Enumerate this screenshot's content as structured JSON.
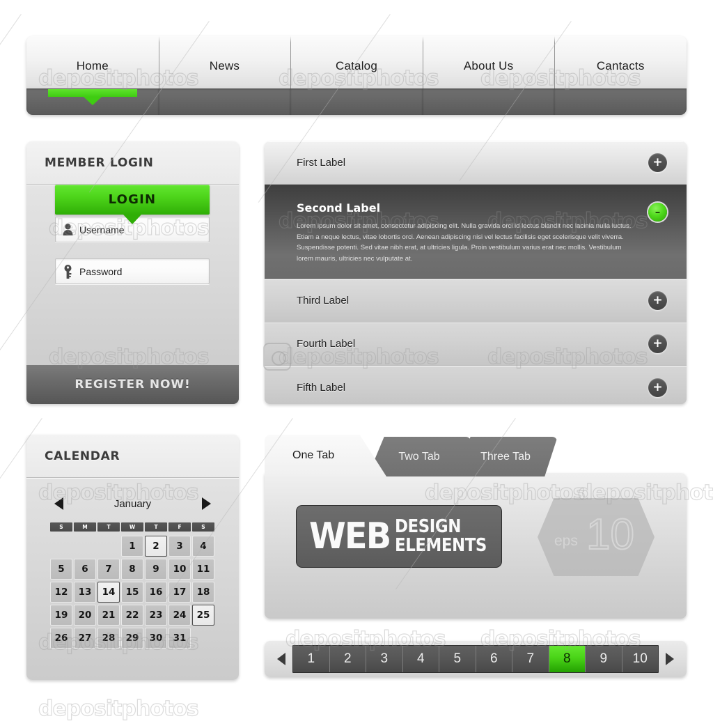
{
  "nav": {
    "items": [
      {
        "label": "Home",
        "active": true
      },
      {
        "label": "News",
        "active": false
      },
      {
        "label": "Catalog",
        "active": false
      },
      {
        "label": "About Us",
        "active": false
      },
      {
        "label": "Cantacts",
        "active": false
      }
    ]
  },
  "login": {
    "title": "MEMBER LOGIN",
    "username": {
      "placeholder": "Username",
      "icon": "user-icon"
    },
    "password": {
      "placeholder": "Password",
      "icon": "key-icon"
    },
    "login_button": "LOGIN",
    "register_label": "REGISTER NOW!"
  },
  "accordion": {
    "items": [
      {
        "label": "First Label",
        "open": false,
        "sign": "+"
      },
      {
        "label": "Second Label",
        "open": true,
        "sign": "–",
        "body": "Lorem ipsum dolor sit amet, consectetur adipiscing elit. Nulla gravida orci id lectus blandit nec lacinia nulla luctus. Etiam a neque lectus, vitae lobortis orci. Aenean adipiscing nisi vel lectus facilisis eget scelerisque velit viverra. Suspendisse potenti. Sed vitae nibh erat, at ultricies ligula. Proin vestibulum varius erat nec mollis.  Vestibulum lorem mauris, ultricies nec vulputate at."
      },
      {
        "label": "Third Label",
        "open": false,
        "sign": "+"
      },
      {
        "label": "Fourth Label",
        "open": false,
        "sign": "+"
      },
      {
        "label": "Fifth Label",
        "open": false,
        "sign": "+"
      }
    ]
  },
  "calendar": {
    "title": "CALENDAR",
    "month": "January",
    "prev_icon": "triangle-left-icon",
    "next_icon": "triangle-right-icon",
    "dow": [
      "S",
      "M",
      "T",
      "W",
      "T",
      "F",
      "S"
    ],
    "lead_blanks": 3,
    "days": [
      1,
      2,
      3,
      4,
      5,
      6,
      7,
      8,
      9,
      10,
      11,
      12,
      13,
      14,
      15,
      16,
      17,
      18,
      19,
      20,
      21,
      22,
      23,
      24,
      25,
      26,
      27,
      28,
      29,
      30,
      31
    ],
    "selected_days": [
      2,
      14,
      25
    ]
  },
  "tabs": {
    "items": [
      {
        "label": "One Tab",
        "active": true
      },
      {
        "label": "Two Tab",
        "active": false
      },
      {
        "label": "Three Tab",
        "active": false
      }
    ],
    "badge": {
      "web": "WEB",
      "line1": "DESIGN",
      "line2": "ELEMENTS"
    },
    "eps": {
      "prefix": "eps",
      "version": "10"
    }
  },
  "pagination": {
    "prev_icon": "triangle-left-icon",
    "next_icon": "triangle-right-icon",
    "pages": [
      "1",
      "2",
      "3",
      "4",
      "5",
      "6",
      "7",
      "8",
      "9",
      "10"
    ],
    "active_page": "8"
  },
  "watermark": {
    "text": "depositphotos"
  },
  "colors": {
    "accent_green_light": "#63e731",
    "accent_green_dark": "#2fae06",
    "dark_panel": "#4c4c4c",
    "panel_light": "#e4e4e4"
  }
}
